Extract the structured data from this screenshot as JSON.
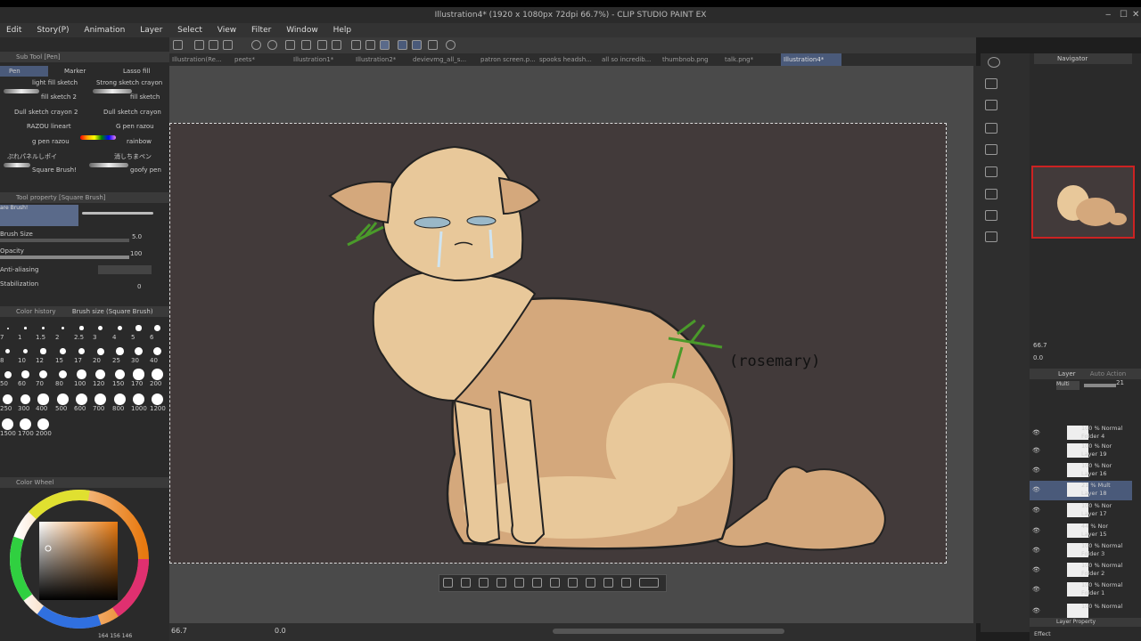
{
  "window": {
    "title": "Illustration4* (1920 x 1080px 72dpi 66.7%) - CLIP STUDIO PAINT EX"
  },
  "menu": [
    "Edit",
    "Story(P)",
    "Animation",
    "Layer",
    "Select",
    "View",
    "Filter",
    "Window",
    "Help"
  ],
  "tabs": [
    "Illustration(Re...",
    "peets*",
    "Illustration1*",
    "Illustration2*",
    "devievmg_all_s...",
    "patron screen.p...",
    "spooks headsh...",
    "all so incredib...",
    "thumbnob.png",
    "talk.png*",
    "Illustration4*"
  ],
  "sub_tool": {
    "header": "Sub Tool [Pen]",
    "tabs": [
      "Pen",
      "Marker",
      "Lasso fill"
    ],
    "brushes_left": [
      "light fill sketch",
      "fill sketch 2",
      "Dull sketch crayon 2",
      "RAZOU lineart",
      "g pen razou",
      "ぷれパネルしポイ",
      "Square Brush!"
    ],
    "brushes_right": [
      "Strong sketch crayon",
      "fill sketch",
      "Dull sketch crayon",
      "G pen razou",
      "rainbow",
      "消しちまペン",
      "goofy pen"
    ]
  },
  "tool_property": {
    "header": "Tool property [Square Brush]",
    "brush_name": "are Brush!",
    "brush_size_label": "Brush Size",
    "brush_size_value": "5.0",
    "opacity_label": "Opacity",
    "opacity_value": "100",
    "antialias_label": "Anti-aliasing",
    "stabilization_label": "Stabilization",
    "stabilization_value": "0"
  },
  "brush_size_panel": {
    "header_left": "Color history",
    "header_right": "Brush size (Square Brush)",
    "sizes": [
      "7",
      "1",
      "1.5",
      "2",
      "2.5",
      "3",
      "4",
      "5",
      "6",
      "8",
      "10",
      "12",
      "15",
      "17",
      "20",
      "25",
      "30",
      "40",
      "50",
      "60",
      "70",
      "80",
      "100",
      "120",
      "150",
      "170",
      "200",
      "250",
      "300",
      "400",
      "500",
      "600",
      "700",
      "800",
      "1000",
      "1200",
      "1500",
      "1700",
      "2000"
    ]
  },
  "color_wheel": {
    "header": "Color Wheel",
    "rgb": "164 156 146"
  },
  "canvas": {
    "annotation": "(rosemary)"
  },
  "navigator": {
    "header": "Navigator",
    "zoom": "66.7",
    "rotate": "0.0"
  },
  "layers": {
    "header_left": "Layer",
    "header_right": "Auto Action",
    "blend": "Multi",
    "opacity_value": "21",
    "rows": [
      {
        "pct": "100 % Normal",
        "name": "Folder 4"
      },
      {
        "pct": "100 % Nor",
        "name": "Layer 19"
      },
      {
        "pct": "100 % Nor",
        "name": "Layer 16"
      },
      {
        "pct": "21 % Mult",
        "name": "Layer 18"
      },
      {
        "pct": "100 % Nor",
        "name": "Layer 17"
      },
      {
        "pct": "44 % Nor",
        "name": "Layer 15"
      },
      {
        "pct": "100 % Normal",
        "name": "Folder 3"
      },
      {
        "pct": "100 % Normal",
        "name": "Folder 2"
      },
      {
        "pct": "100 % Normal",
        "name": "Folder 1"
      },
      {
        "pct": "100 % Normal",
        "name": ""
      }
    ],
    "footer": "Layer Property",
    "footer2": "Effect"
  },
  "status": {
    "zoom": "66.7",
    "angle": "0.0"
  },
  "colors": {
    "accent": "#4a5a7a",
    "canvas_bg": "#423a3a",
    "cat_light": "#e8c89a",
    "cat_dark": "#d4a87c",
    "nav_border": "#cc2222"
  }
}
